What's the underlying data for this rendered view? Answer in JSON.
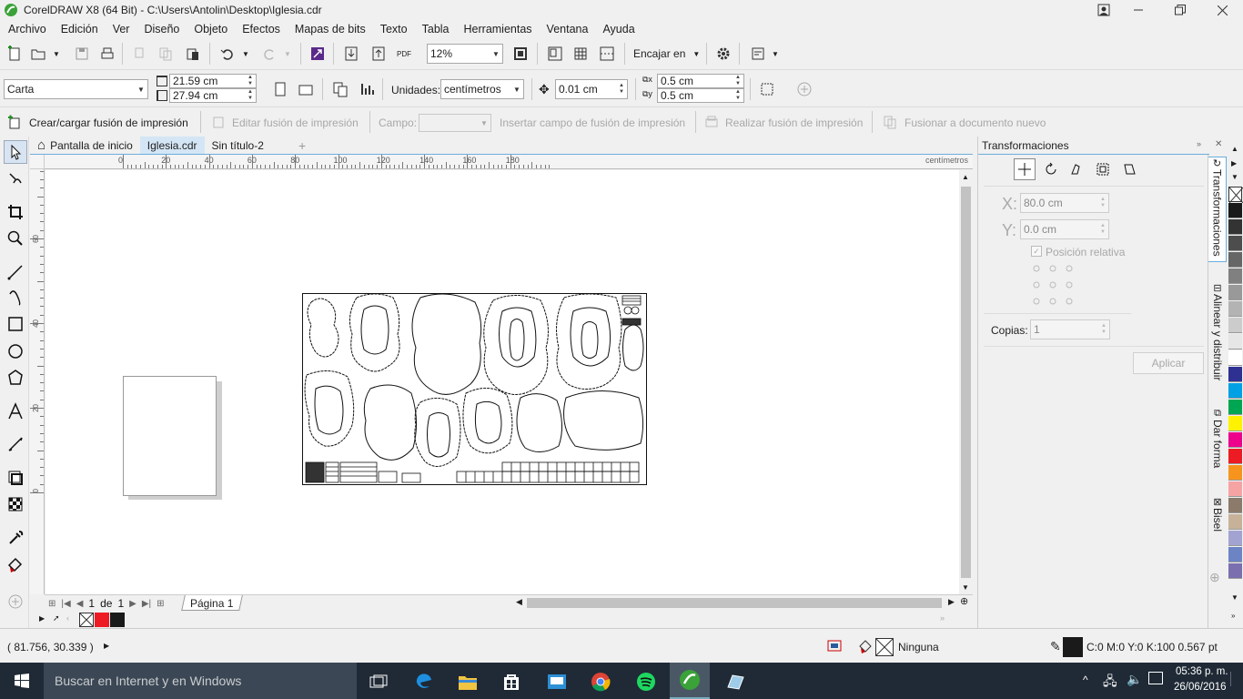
{
  "title_bar": {
    "title": "CorelDRAW X8 (64 Bit) - C:\\Users\\Antolin\\Desktop\\Iglesia.cdr"
  },
  "menu": [
    "Archivo",
    "Edición",
    "Ver",
    "Diseño",
    "Objeto",
    "Efectos",
    "Mapas de bits",
    "Texto",
    "Tabla",
    "Herramientas",
    "Ventana",
    "Ayuda"
  ],
  "standard_toolbar": {
    "zoom_value": "12%",
    "snap_label": "Encajar en",
    "pdf_label": "PDF"
  },
  "property_bar": {
    "page_size": "Carta",
    "width": "21.59 cm",
    "height": "27.94 cm",
    "units_label": "Unidades:",
    "units_value": "centímetros",
    "nudge": "0.01 cm",
    "dup_x": "0.5 cm",
    "dup_y": "0.5 cm"
  },
  "merge_bar": {
    "create": "Crear/cargar fusión de impresión",
    "edit": "Editar fusión de impresión",
    "field_label": "Campo:",
    "insert": "Insertar campo de fusión de impresión",
    "perform": "Realizar fusión de impresión",
    "merge_new": "Fusionar a documento nuevo"
  },
  "doc_tabs": [
    {
      "label": "Pantalla de inicio",
      "active": false
    },
    {
      "label": "Iglesia.cdr",
      "active": true
    },
    {
      "label": "Sin título-2",
      "active": false
    }
  ],
  "ruler": {
    "ticks": [
      "0",
      "20",
      "40",
      "60",
      "80",
      "100",
      "120",
      "140",
      "160",
      "180"
    ],
    "units": "centímetros",
    "v_ticks": [
      "0",
      "20",
      "40",
      "60",
      "80",
      "100"
    ]
  },
  "page_nav": {
    "current": "1",
    "of_label": "de",
    "total": "1",
    "page_tab": "Página 1"
  },
  "status": {
    "coords": "( 81.756, 30.339 )",
    "fill_label": "Ninguna",
    "outline_info": "C:0 M:0 Y:0 K:100  0.567 pt"
  },
  "docker": {
    "title": "Transformaciones",
    "x_label": "X:",
    "x_value": "80.0 cm",
    "y_label": "Y:",
    "y_value": "0.0 cm",
    "relative_label": "Posición relativa",
    "copies_label": "Copias:",
    "copies_value": "1",
    "apply_label": "Aplicar"
  },
  "dock_tabs": [
    "Transformaciones",
    "Alinear y distribuir",
    "Dar forma",
    "Bisel"
  ],
  "palette_colors": [
    "#ffffff",
    "#1a1a1a",
    "#333333",
    "#4d4d4d",
    "#666666",
    "#808080",
    "#999999",
    "#b3b3b3",
    "#cccccc",
    "#e6e6e6",
    "#ffffff",
    "#2e3192",
    "#00a0e4",
    "#00a651",
    "#fff200",
    "#ec008c",
    "#ed1c24",
    "#f7941d",
    "#f5a3a3",
    "#8c7b6b",
    "#c7b299",
    "#a3a3d1",
    "#6d84c4",
    "#7b6fb0"
  ],
  "taskbar": {
    "search_placeholder": "Buscar en Internet y en Windows",
    "time": "05:36 p. m.",
    "date": "26/06/2016"
  }
}
